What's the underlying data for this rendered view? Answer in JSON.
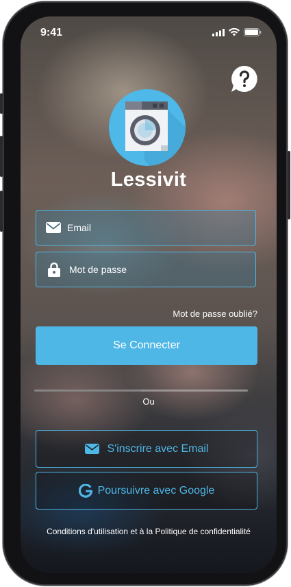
{
  "status_bar": {
    "time": "9:41"
  },
  "app": {
    "name": "Lessivit"
  },
  "login_form": {
    "email_placeholder": "Email",
    "password_placeholder": "Mot de passe",
    "forgot_password": "Mot de passe oublié?",
    "submit_label": "Se Connecter"
  },
  "separator": {
    "label": "Ou"
  },
  "alt_auth": {
    "email_signup": "S'inscrire avec Email",
    "google": "Poursuivre avec Google"
  },
  "legal": {
    "terms": "Conditions d'utilisation et à la Politique de confidentialité"
  },
  "colors": {
    "accent": "#4fb7e6",
    "logo_bg": "#4eb8e8"
  }
}
